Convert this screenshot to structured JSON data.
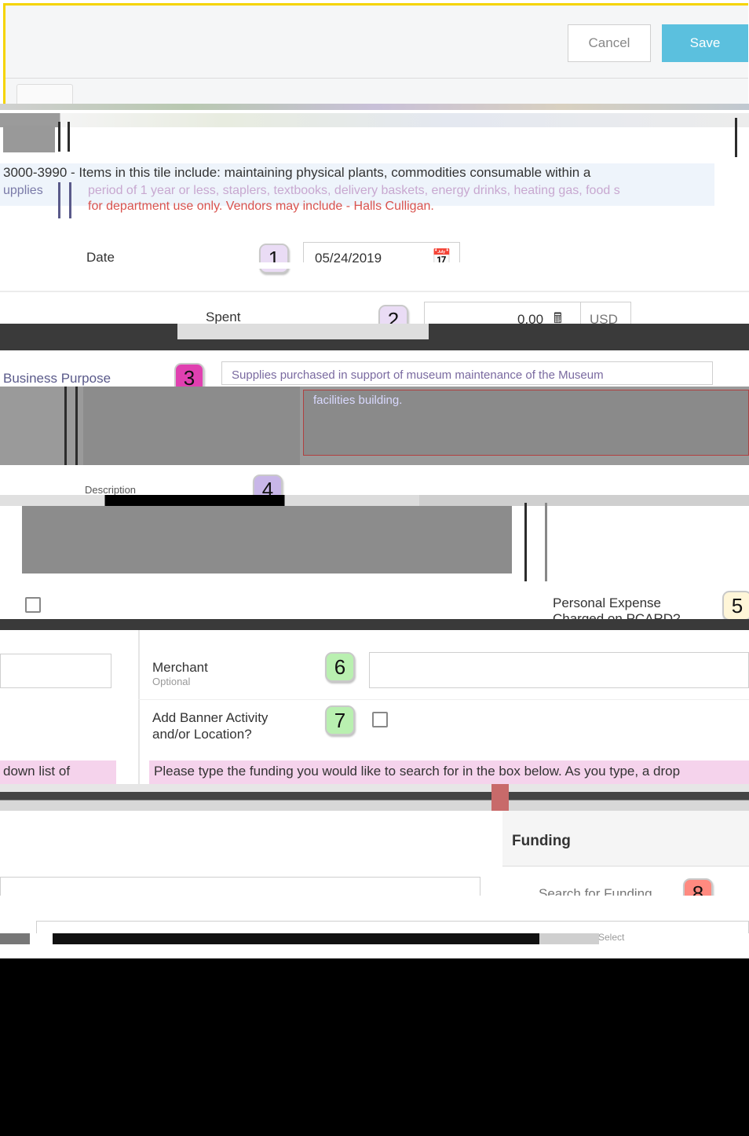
{
  "header": {
    "cancel_label": "Cancel",
    "save_label": "Save"
  },
  "info": {
    "main": "3000-3990 - Items in this tile include: maintaining physical plants, commodities consumable within a",
    "left": "upplies",
    "red1": "period of 1 year or less, staplers, textbooks, delivery baskets, energy drinks, heating gas, food s",
    "red2": "for department use only. Vendors may include - Halls Culligan."
  },
  "fields": {
    "date_label": "Date",
    "date_value": "05/24/2019",
    "spent_label": "Spent",
    "spent_value": "0.00",
    "currency": "USD",
    "business_purpose_label": "Business Purpose",
    "business_purpose_value": "Supplies purchased in support of museum maintenance of the Museum",
    "business_purpose_cont": "facilities building.",
    "description_label": "Description",
    "personal_expense_label": "Personal Expense",
    "charged_on_pcard_label": "Charged on PCARD?",
    "merchant_label": "Merchant",
    "merchant_sub": "Optional",
    "banner_label_1": "Add Banner Activity",
    "banner_label_2": "and/or Location?",
    "left_hint": "down list of",
    "funding_hint": "Please type the funding you would like to search for in the box below. As you type, a drop",
    "funding_title": "Funding",
    "funding_search_placeholder": "Search for Funding",
    "select_label": "Select"
  },
  "badges": {
    "b1": "1",
    "b2": "2",
    "b3": "3",
    "b4": "4",
    "b5": "5",
    "b6": "6",
    "b7": "7",
    "b8": "8"
  },
  "colors": {
    "accent_blue": "#5bc0de",
    "highlight_yellow": "#f5d400",
    "badge1": "#eadcf5",
    "badge2": "#eadcf5",
    "badge3": "#e040b0",
    "badge4": "#c8b6e8",
    "badge5": "#fff6d8",
    "badge6": "#b9f0b0",
    "badge7": "#b9f0b0",
    "badge8": "#ff8a80",
    "error_red": "#d9534f",
    "hint_pink": "#f5d3ec"
  }
}
